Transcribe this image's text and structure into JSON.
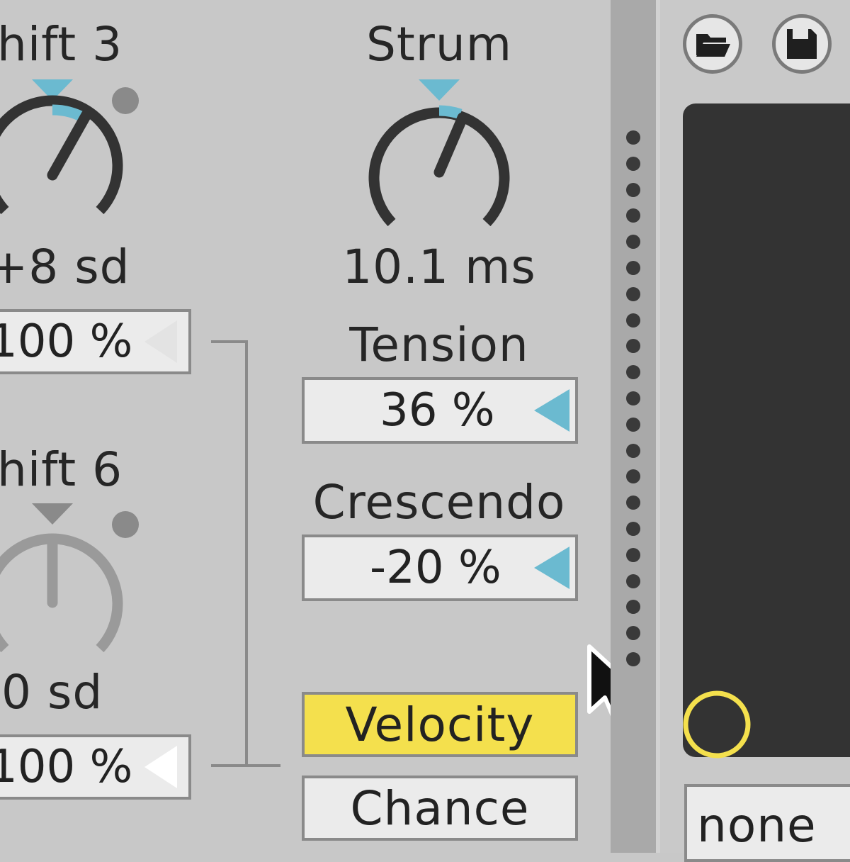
{
  "left_column": {
    "shift3": {
      "label": "hift 3",
      "value": "+8 sd",
      "percent": "100 %"
    },
    "shift6": {
      "label": "hift 6",
      "value": "0 sd",
      "percent": "100 %"
    }
  },
  "middle_column": {
    "strum": {
      "label": "Strum",
      "value": "10.1 ms"
    },
    "tension": {
      "label": "Tension",
      "value": "36 %"
    },
    "crescendo": {
      "label": "Crescendo",
      "value": "-20 %"
    },
    "velocity_button": "Velocity",
    "chance_button": "Chance"
  },
  "right_panel": {
    "open_icon": "folder-icon",
    "save_icon": "floppy-disk-icon",
    "dropdown_value": "none"
  },
  "colors": {
    "background": "#c8c8c8",
    "accent_blue": "#6bbad0",
    "active_yellow": "#f4e04d",
    "knob_dark": "#333333",
    "knob_disabled": "#9a9a9a",
    "pad": "#333333",
    "pad_handle": "#f4e04d"
  }
}
